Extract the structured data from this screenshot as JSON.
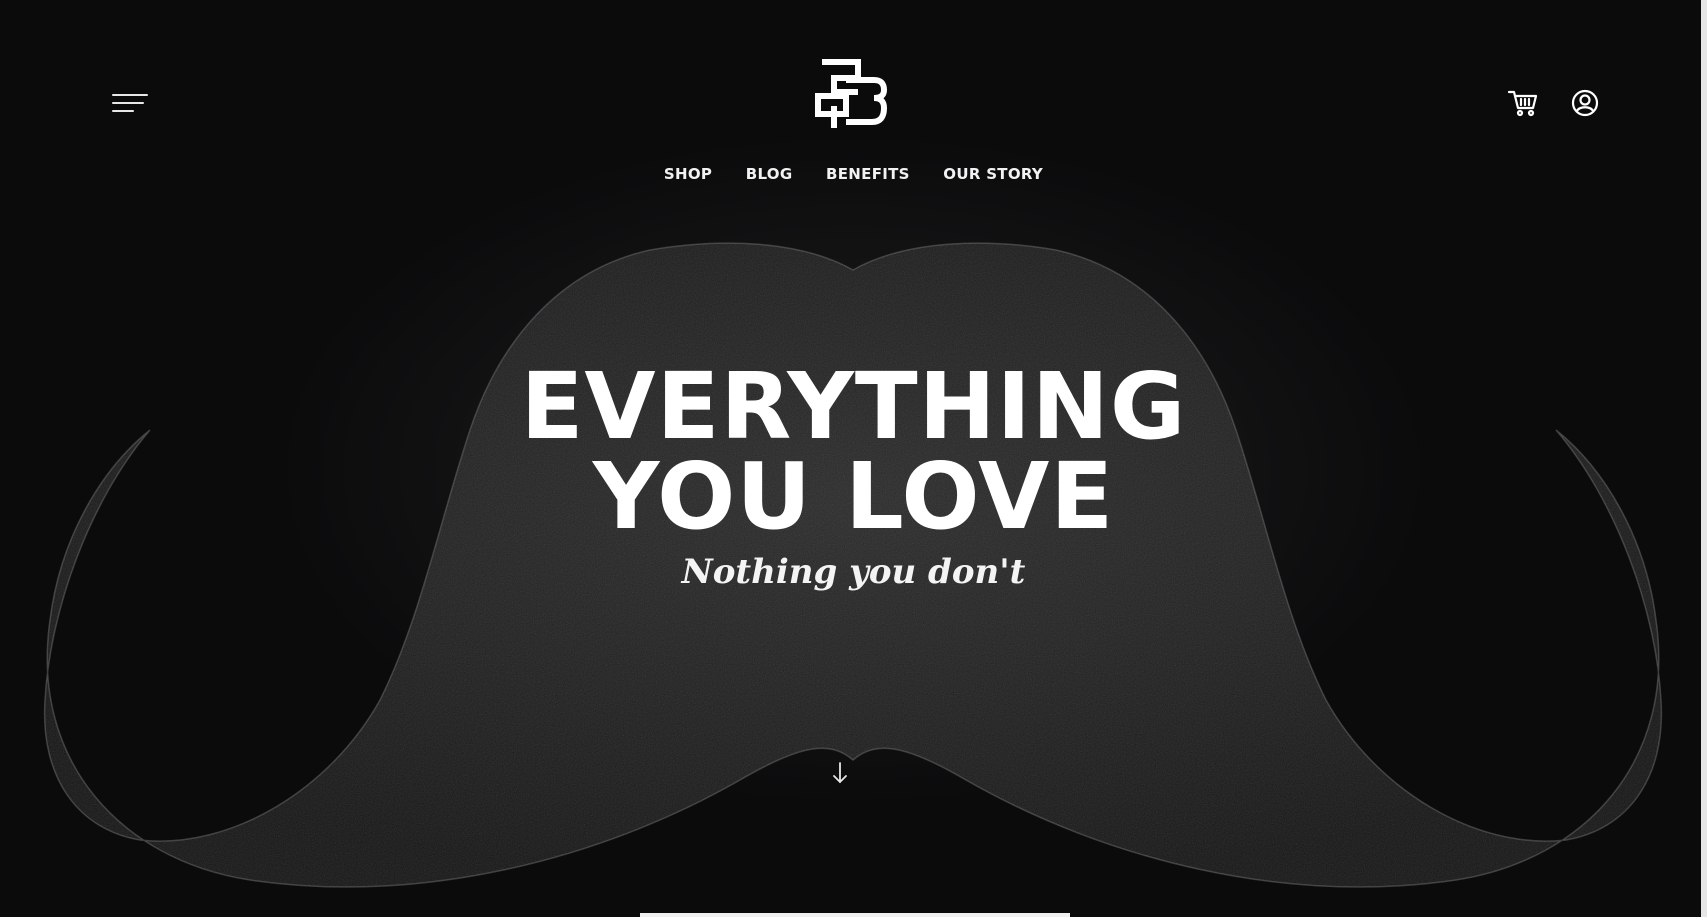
{
  "header": {
    "menu_icon": "hamburger-menu-icon",
    "logo_icon": "monogram-logo-icon",
    "cart_icon": "shopping-cart-icon",
    "account_icon": "user-account-icon"
  },
  "nav": {
    "items": [
      {
        "label": "SHOP"
      },
      {
        "label": "BLOG"
      },
      {
        "label": "BENEFITS"
      },
      {
        "label": "OUR STORY"
      }
    ]
  },
  "hero": {
    "title_line1": "EVERYTHING",
    "title_line2": "YOU LOVE",
    "subtitle": "Nothing you don't",
    "scroll_icon": "arrow-down-icon"
  },
  "colors": {
    "background": "#0b0b0c",
    "text": "#ffffff",
    "mustache": "#6a6a6a"
  }
}
